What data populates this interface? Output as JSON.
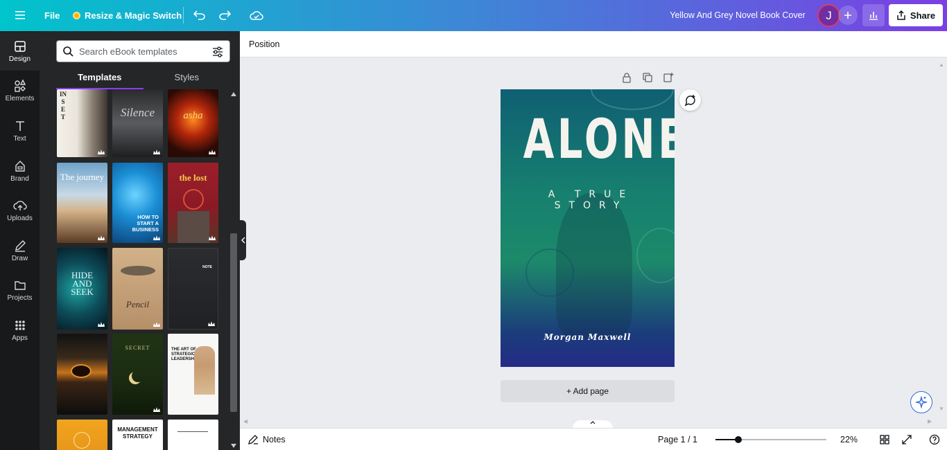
{
  "topbar": {
    "file_label": "File",
    "resize_label": "Resize & Magic Switch",
    "doc_title": "Yellow And Grey Novel Book Cover",
    "avatar_initial": "J",
    "share_label": "Share"
  },
  "rail": {
    "items": [
      {
        "label": "Design",
        "icon": "design-icon"
      },
      {
        "label": "Elements",
        "icon": "elements-icon"
      },
      {
        "label": "Text",
        "icon": "text-icon"
      },
      {
        "label": "Brand",
        "icon": "brand-icon"
      },
      {
        "label": "Uploads",
        "icon": "uploads-icon"
      },
      {
        "label": "Draw",
        "icon": "draw-icon"
      },
      {
        "label": "Projects",
        "icon": "projects-icon"
      },
      {
        "label": "Apps",
        "icon": "apps-icon"
      }
    ]
  },
  "panel": {
    "search_placeholder": "Search eBook templates",
    "tabs": [
      "Templates",
      "Styles"
    ],
    "templates": [
      {
        "title": "INSET"
      },
      {
        "title": "Silence"
      },
      {
        "title": "asha"
      },
      {
        "title": "The journey"
      },
      {
        "title": "HOW TO START A BUSINESS"
      },
      {
        "title": "the lost"
      },
      {
        "title": "HIDE AND SEEK"
      },
      {
        "title": "Pencil"
      },
      {
        "title": "NOTE"
      },
      {
        "title": ""
      },
      {
        "title": "SECRET"
      },
      {
        "title": "THE ART OF STRATEGIC LEADERSHIP"
      },
      {
        "title": ""
      },
      {
        "title": "MANAGEMENT STRATEGY"
      },
      {
        "title": ""
      }
    ]
  },
  "context_bar": {
    "position_label": "Position"
  },
  "canvas": {
    "cover_title": "ALONE",
    "cover_subtitle": "A TRUE STORY",
    "cover_author": "Morgan Maxwell",
    "add_page_label": "+ Add page"
  },
  "bottombar": {
    "notes_label": "Notes",
    "page_indicator": "Page 1 / 1",
    "zoom_value": "22%",
    "zoom_level": 0.22
  },
  "colors": {
    "accent": "#8b3dff",
    "topbar_start": "#00c4cc",
    "topbar_end": "#7b3fe4",
    "rail_bg": "#18191b",
    "panel_bg": "#252627",
    "canvas_bg": "#ebecf0"
  }
}
